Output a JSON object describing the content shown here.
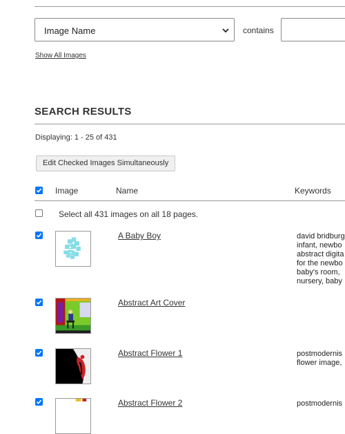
{
  "filter": {
    "field_selected": "Image Name",
    "operator_label": "contains",
    "value": "",
    "show_all_link": "Show All Images"
  },
  "results": {
    "title": "SEARCH RESULTS",
    "displaying": "Displaying: 1 - 25 of 431",
    "edit_button": "Edit Checked Images Simultaneously",
    "columns": {
      "image": "Image",
      "name": "Name",
      "keywords": "Keywords"
    },
    "select_all_label": "Select all 431 images on all 18 pages.",
    "rows": [
      {
        "name": "A Baby Boy",
        "checked": true,
        "thumb_icon": "abstract-baby-art-thumbnail",
        "keywords": "david bridburg,\ninfant, newbo\nabstract digita\nfor the newbo\nbaby's room,\nnursery, baby"
      },
      {
        "name": "Abstract Art Cover",
        "checked": true,
        "thumb_icon": "abstract-art-cover-thumbnail",
        "keywords": ""
      },
      {
        "name": "Abstract Flower 1",
        "checked": true,
        "thumb_icon": "abstract-flower-thumbnail",
        "keywords": "postmodernis\nflower image,"
      },
      {
        "name": "Abstract Flower 2",
        "checked": true,
        "thumb_icon": "abstract-flower-2-thumbnail",
        "keywords": "postmodernis"
      }
    ]
  },
  "colors": {
    "checkbox_accent": "#0075ff",
    "rule": "#9a9a9a"
  }
}
